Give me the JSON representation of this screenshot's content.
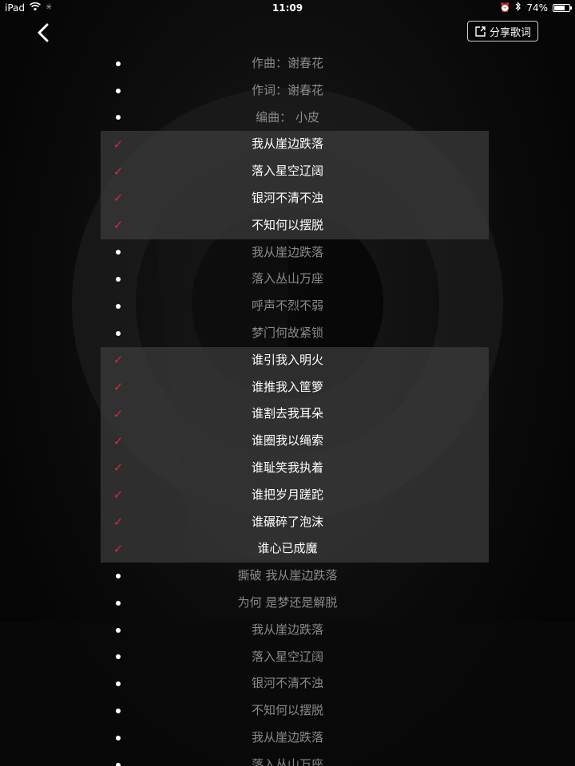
{
  "status_bar": {
    "device": "iPad",
    "time": "11:09",
    "battery": "74%",
    "battery_level": 0.74
  },
  "nav": {
    "share_label": "分享歌词"
  },
  "lyrics": [
    {
      "text": "作曲：谢春花",
      "selected": false
    },
    {
      "text": "作词：谢春花",
      "selected": false
    },
    {
      "text": "编曲： 小皮",
      "selected": false
    },
    {
      "text": "我从崖边跌落",
      "selected": true
    },
    {
      "text": "落入星空辽阔",
      "selected": true
    },
    {
      "text": "银河不清不浊",
      "selected": true
    },
    {
      "text": "不知何以摆脱",
      "selected": true
    },
    {
      "text": "我从崖边跌落",
      "selected": false
    },
    {
      "text": "落入丛山万座",
      "selected": false
    },
    {
      "text": "呼声不烈不弱",
      "selected": false
    },
    {
      "text": "梦门何故紧锁",
      "selected": false
    },
    {
      "text": "谁引我入明火",
      "selected": true
    },
    {
      "text": "谁推我入筐箩",
      "selected": true
    },
    {
      "text": "谁割去我耳朵",
      "selected": true
    },
    {
      "text": "谁圈我以绳索",
      "selected": true
    },
    {
      "text": "谁耻笑我执着",
      "selected": true
    },
    {
      "text": "谁把岁月蹉跎",
      "selected": true
    },
    {
      "text": "谁碾碎了泡沫",
      "selected": true
    },
    {
      "text": "谁心已成魔",
      "selected": true
    },
    {
      "text": "撕破 我从崖边跌落",
      "selected": false
    },
    {
      "text": "为何 是梦还是解脱",
      "selected": false
    },
    {
      "text": "我从崖边跌落",
      "selected": false
    },
    {
      "text": "落入星空辽阔",
      "selected": false
    },
    {
      "text": "银河不清不浊",
      "selected": false
    },
    {
      "text": "不知何以摆脱",
      "selected": false
    },
    {
      "text": "我从崖边跌落",
      "selected": false
    },
    {
      "text": "落入丛山万座",
      "selected": false
    }
  ],
  "colors": {
    "check": "#e0243a",
    "selected_bg": "#3c3c3c",
    "unselected_text": "#8a8a8a"
  },
  "icons": {
    "back": "chevron-left-icon",
    "share": "share-icon",
    "wifi": "wifi-icon",
    "alarm": "alarm-icon",
    "bluetooth": "bluetooth-icon"
  }
}
